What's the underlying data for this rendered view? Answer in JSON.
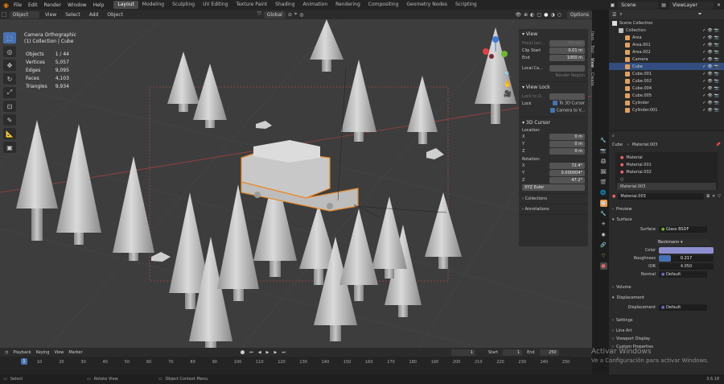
{
  "topbar": {
    "menus": [
      "File",
      "Edit",
      "Render",
      "Window",
      "Help"
    ],
    "workspaces": [
      "Layout",
      "Modeling",
      "Sculpting",
      "UV Editing",
      "Texture Paint",
      "Shading",
      "Animation",
      "Rendering",
      "Compositing",
      "Geometry Nodes",
      "Scripting"
    ],
    "scene": "Scene",
    "view_layer": "ViewLayer"
  },
  "viewport_header": {
    "mode": "Object Mode",
    "menus": [
      "View",
      "Select",
      "Add",
      "Object"
    ],
    "orientation": "Global",
    "options": "Options"
  },
  "viewport": {
    "view_name": "Camera Orthographic",
    "collection_path": "(1) Collection | Cube",
    "stats": [
      {
        "label": "Objects",
        "value": "1 / 44"
      },
      {
        "label": "Vertices",
        "value": "5,057"
      },
      {
        "label": "Edges",
        "value": "9,095"
      },
      {
        "label": "Faces",
        "value": "4,103"
      },
      {
        "label": "Triangles",
        "value": "9,934"
      }
    ]
  },
  "npanel": {
    "view_title": "View",
    "focal_label": "Focal Len...",
    "focal_value": "50 mm",
    "clip_label": "Clip Start",
    "clip_value": "0.01 m",
    "end_label": "End",
    "end_value": "1000 m",
    "local_camera": "Local Ca...",
    "render_region": "Render Region",
    "view_lock_title": "View Lock",
    "lock_to_obj": "Lock to O...",
    "lock_label": "Lock",
    "to_3d_cursor": "To 3D Cursor",
    "camera_to_view": "Camera to V...",
    "cursor_title": "3D Cursor",
    "location_label": "Location:",
    "loc_x": "0 m",
    "loc_y": "0 m",
    "loc_z": "0 m",
    "rotation_label": "Rotation:",
    "rot_x": "72.4°",
    "rot_y": "0.000004°",
    "rot_z": "47.2°",
    "rot_mode": "XYZ Euler",
    "collections": "Collections",
    "annotations": "Annotations",
    "tabs": [
      "Item",
      "Tool",
      "View",
      "Create"
    ]
  },
  "outliner": {
    "title": "Scene Collection",
    "items": [
      {
        "name": "Collection",
        "indent": 1,
        "sel": false,
        "color": "#bdbdbd"
      },
      {
        "name": "Area",
        "indent": 2,
        "sel": false,
        "color": "#e0a060"
      },
      {
        "name": "Area.001",
        "indent": 2,
        "sel": false,
        "color": "#e0a060"
      },
      {
        "name": "Area.002",
        "indent": 2,
        "sel": false,
        "color": "#e0a060"
      },
      {
        "name": "Camera",
        "indent": 2,
        "sel": false,
        "color": "#e0a060"
      },
      {
        "name": "Cube",
        "indent": 2,
        "sel": true,
        "color": "#e0a060"
      },
      {
        "name": "Cube.001",
        "indent": 2,
        "sel": false,
        "color": "#e0a060"
      },
      {
        "name": "Cube.002",
        "indent": 2,
        "sel": false,
        "color": "#e0a060"
      },
      {
        "name": "Cube.004",
        "indent": 2,
        "sel": false,
        "color": "#e0a060"
      },
      {
        "name": "Cube.005",
        "indent": 2,
        "sel": false,
        "color": "#e0a060"
      },
      {
        "name": "Cylinder",
        "indent": 2,
        "sel": false,
        "color": "#e0a060"
      },
      {
        "name": "Cylinder.001",
        "indent": 2,
        "sel": false,
        "color": "#e0a060"
      }
    ]
  },
  "properties": {
    "object": "Cube",
    "material_path": "Material.003",
    "slots": [
      "Material",
      "Material.001",
      "Material.002",
      "",
      "Material.003"
    ],
    "active_material": "Material.003",
    "preview": "Preview",
    "surface_section": "Surface",
    "surface_label": "Surface",
    "surface_value": "Glass BSDF",
    "distribution": "Beckmann",
    "color_label": "Color",
    "color": "#8f8fd0",
    "roughness_label": "Roughness",
    "roughness_value": "0.217",
    "roughness": 0.217,
    "ior_label": "IOR",
    "ior_value": "4.050",
    "normal_label": "Normal",
    "normal_value": "Default",
    "volume": "Volume",
    "displacement_section": "Displacement",
    "displacement_label": "Displacement",
    "displacement_value": "Default",
    "settings": "Settings",
    "line_art": "Line Art",
    "viewport_display": "Viewport Display",
    "custom_properties": "Custom Properties"
  },
  "timeline": {
    "menus": [
      "Playback",
      "Keying",
      "View",
      "Marker"
    ],
    "current_frame": "1",
    "start_label": "Start",
    "start": "1",
    "end_label": "End",
    "end": "250",
    "ticks": [
      "1",
      "10",
      "20",
      "30",
      "40",
      "50",
      "60",
      "70",
      "80",
      "90",
      "100",
      "110",
      "120",
      "130",
      "140",
      "150",
      "160",
      "170",
      "180",
      "190",
      "200",
      "210",
      "220",
      "230",
      "240",
      "250"
    ]
  },
  "statusbar": {
    "select": "Select",
    "rotate": "Rotate View",
    "context": "Object Context Menu",
    "version": "3.6.18"
  },
  "watermark": {
    "line1": "Activar Windows",
    "line2": "Ve a Configuración para activar Windows."
  }
}
